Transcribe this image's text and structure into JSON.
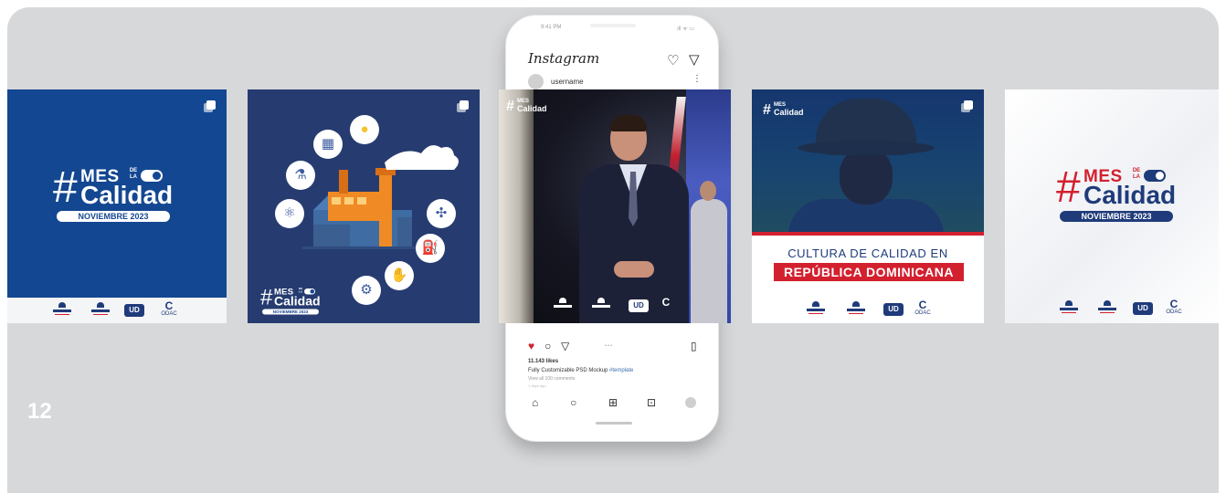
{
  "page_number": "12",
  "campaign_logo": {
    "hash": "#",
    "mes": "MES",
    "de_la": "DE LA",
    "calidad": "Calidad",
    "month": "NOVIEMBRE 2023"
  },
  "partner_logos": {
    "ud": "UD",
    "odac_letter": "C",
    "odac": "ODAC"
  },
  "colors": {
    "background": "#d7d8da",
    "brand_blue": "#134791",
    "navy": "#263c70",
    "brand_red": "#d3202e"
  },
  "phone": {
    "status_time": "9:41 PM",
    "status_icons": "ıll ᯤ ▭",
    "app_name": "Instagram",
    "caret": "⌄",
    "username": "username",
    "more": "⋮",
    "likes": "11.143 likes",
    "caption": "Fully Customizable PSD Mockup",
    "caption_tag": "#template",
    "comments_link": "View all 100 comments",
    "time_ago": "1 days ago",
    "top_icons": [
      "heart-icon",
      "send-icon"
    ],
    "action_icons": [
      "heart-filled-icon",
      "comment-icon",
      "send-icon",
      "carousel-dots",
      "bookmark-icon"
    ],
    "nav_icons": [
      "home-icon",
      "search-icon",
      "add-icon",
      "shop-icon",
      "profile-avatar"
    ],
    "carousel_dots": "• • •"
  },
  "post_culture": {
    "line1": "CULTURA DE CALIDAD EN",
    "line2": "REPÚBLICA DOMINICANA"
  },
  "factory_icons": [
    "meter-icon",
    "bulb-icon",
    "cloud-icon",
    "lab-icon",
    "wind-turbine-icon",
    "chemistry-icon",
    "oil-pump-icon",
    "valve-icon",
    "hand-tool-icon"
  ]
}
